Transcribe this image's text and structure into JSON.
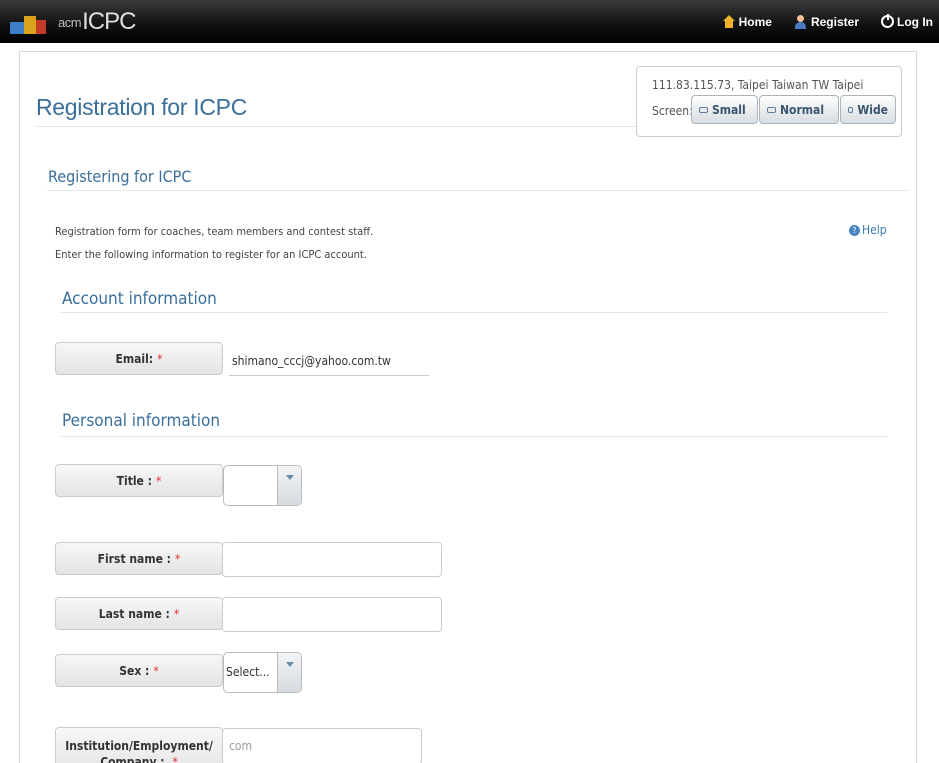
{
  "navbar": {
    "brand_acm": "acm",
    "brand_icpc": "ICPC",
    "links": {
      "home": "Home",
      "register": "Register",
      "login": "Log In"
    },
    "icons": {
      "home": "home-icon",
      "register": "user-add-icon",
      "login": "power-icon"
    }
  },
  "header": {
    "title": "Registration for ICPC",
    "location": "111.83.115.73, Taipei Taiwan TW Taipei",
    "screen_label": "Screen:",
    "screen_buttons": {
      "small": "Small",
      "normal": "Normal",
      "wide": "Wide"
    }
  },
  "main": {
    "section_title": "Registering for ICPC",
    "intro_line1": "Registration form for coaches, team members and contest staff.",
    "intro_line2": "Enter the following information to register for an ICPC account.",
    "help_label": "Help"
  },
  "account": {
    "legend": "Account information",
    "email_label": "Email:",
    "email_value": "shimano_cccj@yahoo.com.tw"
  },
  "personal": {
    "legend": "Personal information",
    "title_label": "Title  :",
    "title_value": "",
    "first_name_label": "First name  :",
    "first_name_value": "",
    "last_name_label": "Last name  :",
    "last_name_value": "",
    "sex_label": "Sex  :",
    "sex_value": "Select...",
    "institution_label": "Institution/Employment/ Company  :",
    "institution_placeholder": "com"
  },
  "required_mark": "*",
  "colors": {
    "accent": "#3a6f9c",
    "required": "#dd3333",
    "navbar": "#111111"
  }
}
